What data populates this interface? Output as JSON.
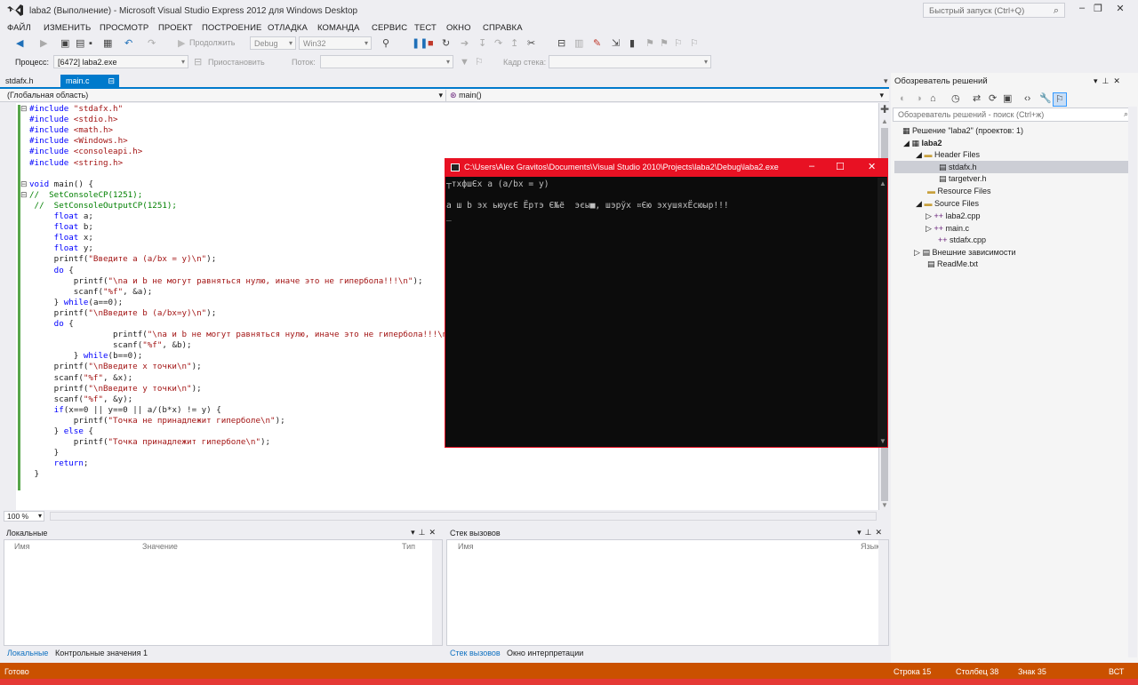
{
  "window": {
    "title": "laba2 (Выполнение) - Microsoft Visual Studio Express 2012 для Windows Desktop",
    "quick_launch_placeholder": "Быстрый запуск (Ctrl+Q)",
    "minimize_icon": "–",
    "restore_icon": "❐",
    "close_icon": "✕"
  },
  "menu": [
    "ФАЙЛ",
    "ИЗМЕНИТЬ",
    "ПРОСМОТР",
    "ПРОЕКТ",
    "ПОСТРОЕНИЕ",
    "ОТЛАДКА",
    "КОМАНДА",
    "СЕРВИС",
    "ТЕСТ",
    "ОКНО",
    "СПРАВКА"
  ],
  "toolbar": {
    "continue_label": "Продолжить",
    "config_value": "Debug",
    "platform_value": "Win32"
  },
  "debug_toolbar": {
    "process_label": "Процесс:",
    "process_value": "[6472] laba2.exe",
    "suspend_label": "Приостановить",
    "thread_label": "Поток:",
    "stack_frame_label": "Кадр стека:"
  },
  "doc_tabs": {
    "tab1": "stdafx.h",
    "tab2": "main.c"
  },
  "navbar": {
    "scope": "(Глобальная область)",
    "member": "main()"
  },
  "code": [
    {
      "t": "#include \"stdafx.h\"",
      "c": "pp"
    },
    {
      "t": "#include <stdio.h>",
      "c": "pp"
    },
    {
      "t": "#include <math.h>",
      "c": "pp"
    },
    {
      "t": "#include <Windows.h>",
      "c": "pp"
    },
    {
      "t": "#include <consoleapi.h>",
      "c": "pp"
    },
    {
      "t": "#include <string.h>",
      "c": "pp"
    },
    {
      "t": "",
      "c": ""
    },
    {
      "t": "void main() {",
      "c": ""
    },
    {
      "t": "//  SetConsoleCP(1251);",
      "c": "cm"
    },
    {
      "t": " //  SetConsoleOutputCP(1251);",
      "c": "cm"
    },
    {
      "t": "     float a;",
      "c": ""
    },
    {
      "t": "     float b;",
      "c": ""
    },
    {
      "t": "     float x;",
      "c": ""
    },
    {
      "t": "     float y;",
      "c": ""
    },
    {
      "t": "     printf(\"Введите a (a/bx = y)\\n\");",
      "c": ""
    },
    {
      "t": "     do {",
      "c": ""
    },
    {
      "t": "         printf(\"\\na и b не могут равняться нулю, иначе это не гипербола!!!\\n\");",
      "c": ""
    },
    {
      "t": "         scanf(\"%f\", &a);",
      "c": ""
    },
    {
      "t": "     } while(a==0);",
      "c": ""
    },
    {
      "t": "     printf(\"\\nВведите b (a/bx=y)\\n\");",
      "c": ""
    },
    {
      "t": "     do {",
      "c": ""
    },
    {
      "t": "                 printf(\"\\na и b не могут равняться нулю, иначе это не гипербола!!!\\n\");",
      "c": ""
    },
    {
      "t": "                 scanf(\"%f\", &b);",
      "c": ""
    },
    {
      "t": "         } while(b==0);",
      "c": ""
    },
    {
      "t": "     printf(\"\\nВведите x точки\\n\");",
      "c": ""
    },
    {
      "t": "     scanf(\"%f\", &x);",
      "c": ""
    },
    {
      "t": "     printf(\"\\nВведите y точки\\n\");",
      "c": ""
    },
    {
      "t": "     scanf(\"%f\", &y);",
      "c": ""
    },
    {
      "t": "     if(x==0 || y==0 || a/(b*x) != y) {",
      "c": ""
    },
    {
      "t": "         printf(\"Точка не принадлежит гиперболе\\n\");",
      "c": ""
    },
    {
      "t": "     } else {",
      "c": ""
    },
    {
      "t": "         printf(\"Точка принадлежит гиперболе\\n\");",
      "c": ""
    },
    {
      "t": "     }",
      "c": ""
    },
    {
      "t": "     return;",
      "c": ""
    },
    {
      "t": " }",
      "c": ""
    }
  ],
  "zoom": "100 %",
  "locals_panel": {
    "title": "Локальные",
    "col_name": "Имя",
    "col_value": "Значение",
    "col_type": "Тип",
    "tab_locals": "Локальные",
    "tab_watch": "Контрольные значения 1"
  },
  "callstack_panel": {
    "title": "Стек вызовов",
    "col_name": "Имя",
    "col_lang": "Язык",
    "tab_callstack": "Стек вызовов",
    "tab_immediate": "Окно интерпретации"
  },
  "solution_explorer": {
    "title": "Обозреватель решений",
    "search_placeholder": "Обозреватель решений - поиск (Ctrl+ж)",
    "solution": "Решение \"laba2\"  (проектов: 1)",
    "project": "laba2",
    "header_files": "Header Files",
    "stdafx_h": "stdafx.h",
    "targetver_h": "targetver.h",
    "resource_files": "Resource Files",
    "source_files": "Source Files",
    "laba2_cpp": "laba2.cpp",
    "main_c": "main.c",
    "stdafx_cpp": "stdafx.cpp",
    "external": "Внешние зависимости",
    "readme": "ReadMe.txt"
  },
  "console": {
    "title": "C:\\Users\\Alex Gravitos\\Documents\\Visual Studio 2010\\Projects\\laba2\\Debug\\laba2.exe",
    "line1": "┬тхфшЄх a (a/bx = y)",
    "line2": "a ш b эх ьюуєЄ Ёртэ Є№ё  эєы■, шэрўх ¤Єю эхушяхЁсюыр!!!",
    "cursor": "_"
  },
  "statusbar": {
    "ready": "Готово",
    "line": "Строка 15",
    "col": "Столбец 38",
    "char": "Знак 35",
    "mode": "ВСТ"
  },
  "colors": {
    "accent": "#007acc",
    "status_bg": "#ca5100",
    "console_border": "#e81123"
  }
}
